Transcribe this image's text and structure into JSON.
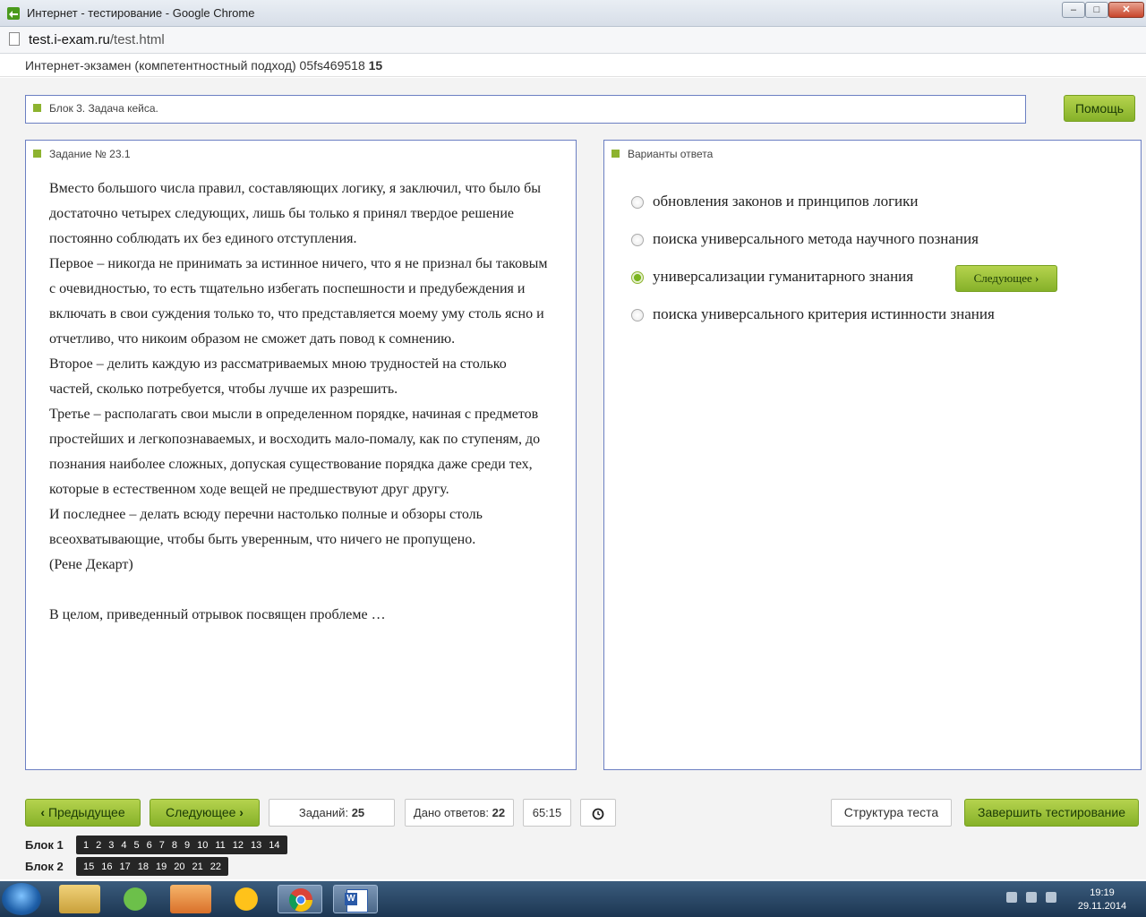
{
  "window": {
    "title": "Интернет - тестирование - Google Chrome",
    "min_label": "–",
    "max_label": "□",
    "close_label": "✕"
  },
  "browser": {
    "url_host": "test.i-exam.ru",
    "url_path": "/test.html"
  },
  "exam": {
    "title": "Интернет-экзамен (компетентностный подход) 05fs469518",
    "number": "15"
  },
  "block_title": "Блок 3. Задача кейса.",
  "help_label": "Помощь",
  "task": {
    "title": "Задание № 23.1",
    "paragraphs": [
      "Вместо большого числа правил, составляющих логику, я заключил, что было бы достаточно четырех следующих, лишь бы только я принял твердое решение постоянно соблюдать их без единого отступления.",
      "Первое – никогда не принимать за истинное ничего, что я не признал бы таковым с очевидностью, то есть тщательно избегать поспешности и предубеждения и включать в свои суждения только то, что представляется моему уму столь ясно и отчетливо, что никоим образом не сможет дать повод к сомнению.",
      "Второе – делить каждую из рассматриваемых мною трудностей на столько частей, сколько потребуется, чтобы лучше их разрешить.",
      "Третье – располагать свои мысли в определенном порядке, начиная с предметов простейших и легкопознаваемых, и восходить мало-помалу, как по ступеням, до познания наиболее сложных, допуская существование порядка даже среди тех, которые в естественном ходе вещей не предшествуют друг другу.",
      "И последнее – делать всюду перечни настолько полные и обзоры столь всеохватывающие, чтобы быть уверенным, что ничего не пропущено.",
      "(Рене Декарт)",
      "",
      "В целом, приведенный отрывок посвящен проблеме …"
    ]
  },
  "answers": {
    "title": "Варианты ответа",
    "options": [
      {
        "text": "обновления законов и принципов логики",
        "selected": false
      },
      {
        "text": "поиска универсального метода научного познания",
        "selected": false
      },
      {
        "text": "универсализации гуманитарного знания",
        "selected": true
      },
      {
        "text": "поиска универсального критерия истинности знания",
        "selected": false
      }
    ],
    "next_inline_label": "Следующее"
  },
  "controls": {
    "prev_label": "Предыдущее",
    "next_label": "Следующее",
    "tasks_label": "Заданий:",
    "tasks_count": "25",
    "answered_label": "Дано ответов:",
    "answered_count": "22",
    "timer": "65:15",
    "structure_label": "Структура теста",
    "finish_label": "Завершить тестирование"
  },
  "blocks": [
    {
      "label": "Блок 1",
      "numbers": [
        "1",
        "2",
        "3",
        "4",
        "5",
        "6",
        "7",
        "8",
        "9",
        "10",
        "11",
        "12",
        "13",
        "14"
      ]
    },
    {
      "label": "Блок 2",
      "numbers": [
        "15",
        "16",
        "17",
        "18",
        "19",
        "20",
        "21",
        "22"
      ]
    }
  ],
  "taskbar": {
    "time": "19:19",
    "date": "29.11.2014",
    "icons": [
      "explorer-icon",
      "utorrent-icon",
      "media-player-icon",
      "mail-agent-icon",
      "chrome-icon",
      "word-icon"
    ]
  },
  "colors": {
    "accent_green": "#8db32f",
    "panel_border": "#6b7fc2",
    "number_bar": "#262626"
  }
}
